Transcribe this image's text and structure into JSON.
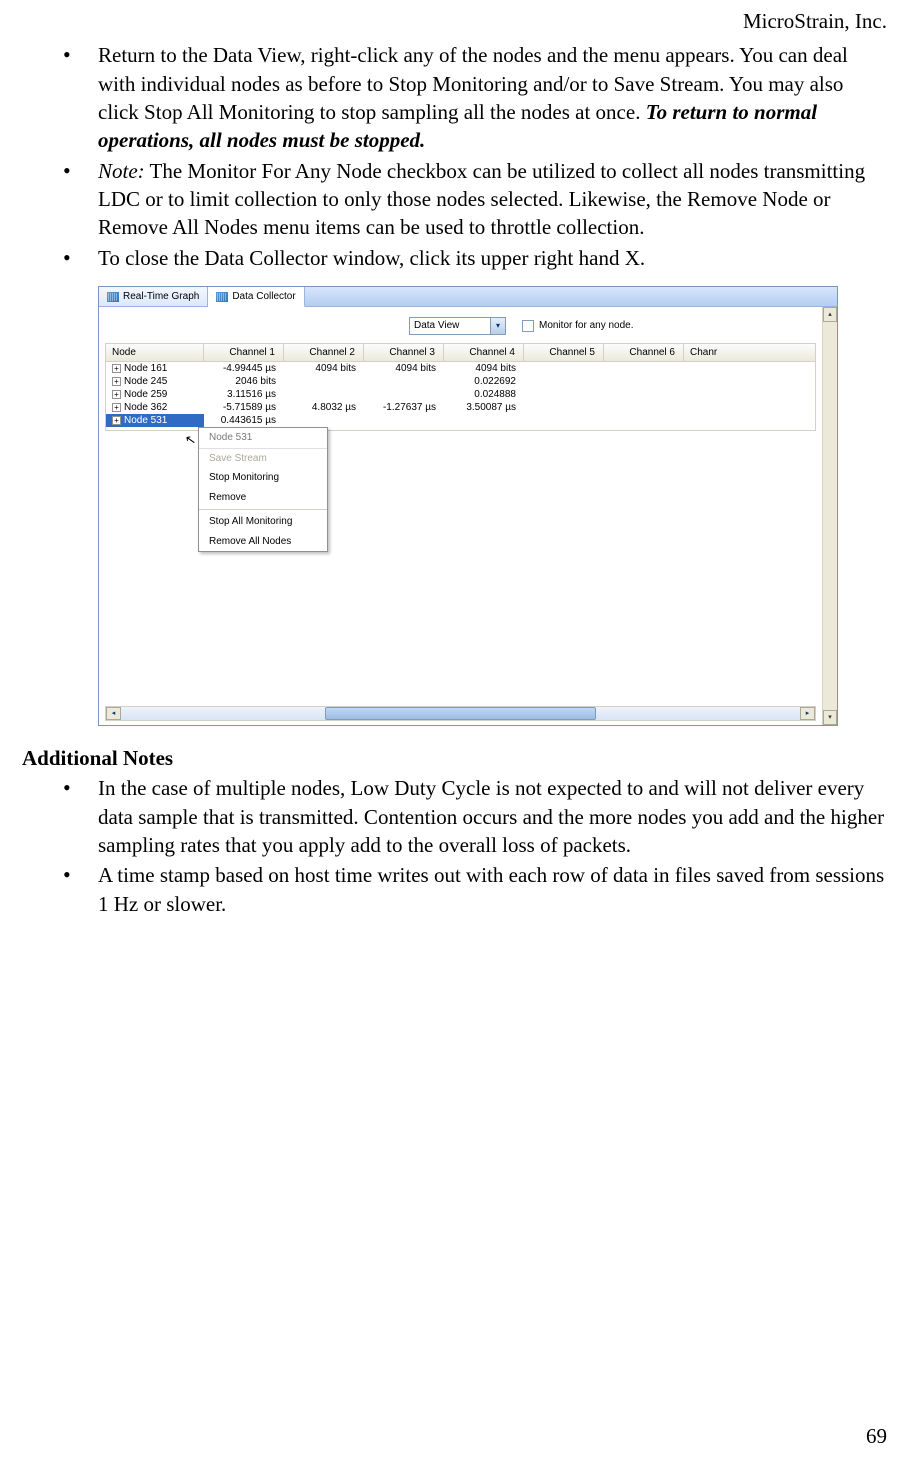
{
  "header": {
    "company": "MicroStrain, Inc."
  },
  "bullets_top": [
    {
      "text": "Return to the Data View, right-click any of the nodes and the menu appears. You can deal with individual nodes as before to Stop Monitoring and/or to Save Stream.  You may also click Stop All Monitoring to stop sampling all the nodes at once. ",
      "emph": "To return to normal operations, all nodes must be stopped."
    },
    {
      "prefix_italic": "Note:",
      "text": " The Monitor For Any Node checkbox can be utilized to collect all nodes transmitting LDC or to limit collection to only those nodes selected.  Likewise, the Remove Node or Remove All Nodes menu items can be used to throttle collection."
    },
    {
      "text": "To close the Data Collector window, click its upper right hand X."
    }
  ],
  "additional_notes_heading": "Additional Notes",
  "bullets_bottom": [
    "In the case of multiple nodes, Low Duty Cycle is not expected to and will not deliver every data sample that is transmitted. Contention occurs and the more nodes you add and the higher sampling rates that you apply add to the overall loss of packets.",
    "A time stamp based on host time writes out with each row of data in files saved from sessions 1 Hz or slower."
  ],
  "page_number": "69",
  "screenshot": {
    "tabs": {
      "graph": "Real-Time Graph",
      "collector": "Data Collector"
    },
    "toolbar": {
      "combo_value": "Data View",
      "checkbox_label": "Monitor for any node."
    },
    "grid": {
      "headers": [
        "Node",
        "Channel 1",
        "Channel 2",
        "Channel 3",
        "Channel 4",
        "Channel 5",
        "Channel 6",
        "Chanr"
      ],
      "rows": [
        {
          "node": "Node 161",
          "c1": "-4.99445 µs",
          "c2": "4094 bits",
          "c3": "4094 bits",
          "c4": "4094 bits"
        },
        {
          "node": "Node 245",
          "c1": "2046 bits",
          "c2": "",
          "c3": "",
          "c4": "0.022692"
        },
        {
          "node": "Node 259",
          "c1": "3.11516 µs",
          "c2": "",
          "c3": "",
          "c4": "0.024888"
        },
        {
          "node": "Node 362",
          "c1": "-5.71589 µs",
          "c2": "4.8032 µs",
          "c3": "-1.27637 µs",
          "c4": "3.50087 µs"
        },
        {
          "node": "Node 531",
          "c1": "0.443615 µs",
          "c2": "",
          "c3": "",
          "c4": "",
          "selected": true
        }
      ]
    },
    "context_menu": {
      "title": "Node 531",
      "items": [
        "Save Stream",
        "Stop Monitoring",
        "Remove"
      ],
      "items2": [
        "Stop All Monitoring",
        "Remove All Nodes"
      ]
    }
  }
}
